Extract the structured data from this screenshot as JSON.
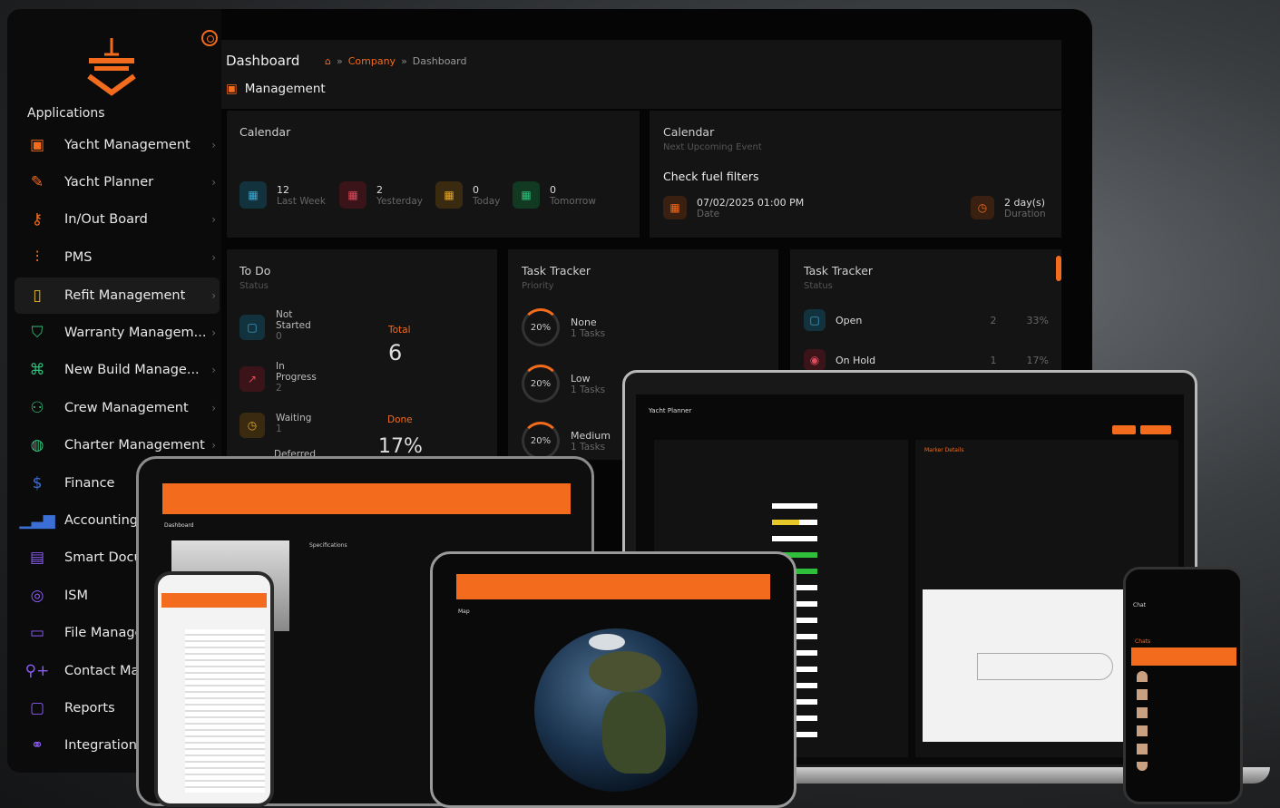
{
  "sidebar": {
    "header": "Applications",
    "items": [
      {
        "label": "Yacht Management",
        "icon": "briefcase-icon"
      },
      {
        "label": "Yacht Planner",
        "icon": "pencil-icon"
      },
      {
        "label": "In/Out Board",
        "icon": "key-icon"
      },
      {
        "label": "PMS",
        "icon": "sliders-icon"
      },
      {
        "label": "Refit Management",
        "icon": "clipboard-icon"
      },
      {
        "label": "Warranty Managem...",
        "icon": "shield-icon"
      },
      {
        "label": "New Build Manage...",
        "icon": "command-icon"
      },
      {
        "label": "Crew Management",
        "icon": "users-icon"
      },
      {
        "label": "Charter Management",
        "icon": "globe-icon"
      },
      {
        "label": "Finance",
        "icon": "dollar-icon"
      },
      {
        "label": "Accounting",
        "icon": "bar-chart-icon"
      },
      {
        "label": "Smart Docu",
        "icon": "document-icon"
      },
      {
        "label": "ISM",
        "icon": "lifebuoy-icon"
      },
      {
        "label": "File Manage",
        "icon": "folder-icon"
      },
      {
        "label": "Contact Mar",
        "icon": "user-plus-icon"
      },
      {
        "label": "Reports",
        "icon": "book-icon"
      },
      {
        "label": "Integrations",
        "icon": "link-icon"
      }
    ]
  },
  "header": {
    "title": "Dashboard",
    "crumb1": "Company",
    "sep": "»",
    "crumb2": "Dashboard",
    "section": "Management"
  },
  "calendar1": {
    "title": "Calendar",
    "stats": [
      {
        "value": "12",
        "label": "Last Week"
      },
      {
        "value": "2",
        "label": "Yesterday"
      },
      {
        "value": "0",
        "label": "Today"
      },
      {
        "value": "0",
        "label": "Tomorrow"
      }
    ]
  },
  "calendar2": {
    "title": "Calendar",
    "subtitle": "Next Upcoming Event",
    "event": "Check fuel filters",
    "date_value": "07/02/2025 01:00 PM",
    "date_label": "Date",
    "duration_value": "2 day(s)",
    "duration_label": "Duration"
  },
  "todo": {
    "title": "To Do",
    "subtitle": "Status",
    "rows": [
      {
        "label": "Not Started",
        "count": "0"
      },
      {
        "label": "In Progress",
        "count": "2"
      },
      {
        "label": "Waiting",
        "count": "1"
      },
      {
        "label": "Deferred",
        "count": ""
      }
    ],
    "total_label": "Total",
    "total_value": "6",
    "done_label": "Done",
    "done_value": "17%"
  },
  "task_priority": {
    "title": "Task Tracker",
    "subtitle": "Priority",
    "rows": [
      {
        "pct": "20%",
        "label": "None",
        "tasks": "1 Tasks"
      },
      {
        "pct": "20%",
        "label": "Low",
        "tasks": "1 Tasks"
      },
      {
        "pct": "20%",
        "label": "Medium",
        "tasks": "1 Tasks"
      }
    ]
  },
  "task_status": {
    "title": "Task Tracker",
    "subtitle": "Status",
    "rows": [
      {
        "label": "Open",
        "count": "2",
        "pct": "33%"
      },
      {
        "label": "On Hold",
        "count": "1",
        "pct": "17%"
      }
    ]
  },
  "laptop": {
    "title": "Yacht Planner",
    "panel": "Marker Details"
  },
  "phone_right": {
    "title": "Chat",
    "section": "Chats"
  },
  "tablet_center": {
    "title": "Map"
  },
  "tablet_left": {
    "title": "Dashboard",
    "section": "Specifications"
  },
  "colors": {
    "accent": "#f36b1c",
    "background": "#050505",
    "card": "#141414"
  }
}
